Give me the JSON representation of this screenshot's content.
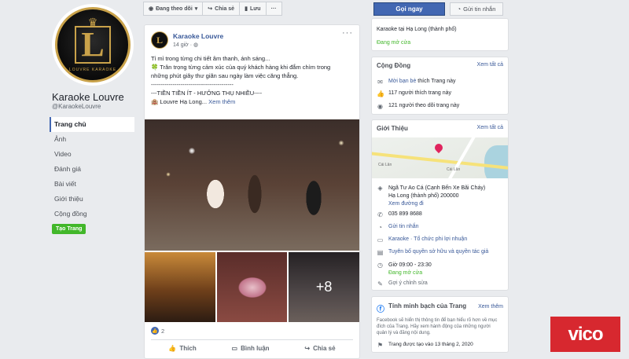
{
  "page": {
    "name": "Karaoke Louvre",
    "handle": "@KaraokeLouvre",
    "logo_text": "L",
    "logo_ring": "LOUVRE KARAOKE",
    "create_page": "Tạo Trang"
  },
  "left_nav": [
    {
      "label": "Trang chủ"
    },
    {
      "label": "Ảnh"
    },
    {
      "label": "Video"
    },
    {
      "label": "Đánh giá"
    },
    {
      "label": "Bài viết"
    },
    {
      "label": "Giới thiệu"
    },
    {
      "label": "Cộng đồng"
    }
  ],
  "topbar": {
    "following": "Đang theo dõi",
    "share": "Chia sẻ",
    "save": "Lưu",
    "more": "···",
    "call": "Gọi ngay",
    "message": "Gửi tin nhắn"
  },
  "post": {
    "author": "Karaoke Louvre",
    "time": "14 giờ",
    "lines": [
      "Tỉ mỉ trong từng chi tiết âm thanh, ánh sáng...",
      "🍀 Trân trọng từng cảm xúc của quý khách hàng khi đắm chìm trong",
      "những phút giây thư giãn sau ngày làm việc căng thẳng.",
      "------------------------------------------",
      "---TIỀN TIỀN ÍT - HƯỞNG THỤ NHIỀU----"
    ],
    "last_line": "🏨 Louvre Hạ Long...",
    "see_more": "Xem thêm",
    "more_photos": "+8",
    "reaction_count": "2",
    "like": "Thích",
    "comment": "Bình luận",
    "share": "Chia sẻ"
  },
  "about_top": {
    "category_location": "Karaoke tại Hạ Long (thành phố)",
    "open_status": "Đang mở cửa"
  },
  "community": {
    "title": "Cộng Đồng",
    "see_all": "Xem tất cả",
    "invite_link": "Mời bạn bè",
    "invite_rest": " thích Trang này",
    "likes": "117 người thích trang này",
    "follows": "121 người theo dõi trang này"
  },
  "about": {
    "title": "Giới Thiệu",
    "see_all": "Xem tất cả",
    "map_label_1": "Cái Lân",
    "map_label_2": "Cái Lân",
    "address_1": "Ngã Tư Ao Cá (Cạnh Bến Xe Bãi Cháy)",
    "address_2": "Hạ Long (thành phố) 200000",
    "directions": "Xem đường đi",
    "phone": "035 899 8688",
    "send_message": "Gửi tin nhắn",
    "category_link": "Karaoke",
    "category_rest": " · Tổ chức phi lợi nhuận",
    "ownership": "Tuyên bố quyền sở hữu và quyền tác giả",
    "hours": "Giờ 09:00 - 23:30",
    "hours_status": "Đang mở cửa",
    "suggest_edit": "Gợi ý chỉnh sửa"
  },
  "transparency": {
    "title": "Tính minh bạch của Trang",
    "see_all": "Xem thêm",
    "text_1": "Facebook sẽ hiển thị thông tin để bạn hiểu rõ hơn về mục",
    "text_2": "đích của Trang. Hãy xem hành động của những người",
    "text_3": "quản lý và đăng nội dung.",
    "created": "Trang được tạo vào 13 tháng 2, 2020"
  },
  "watermark": "vico"
}
